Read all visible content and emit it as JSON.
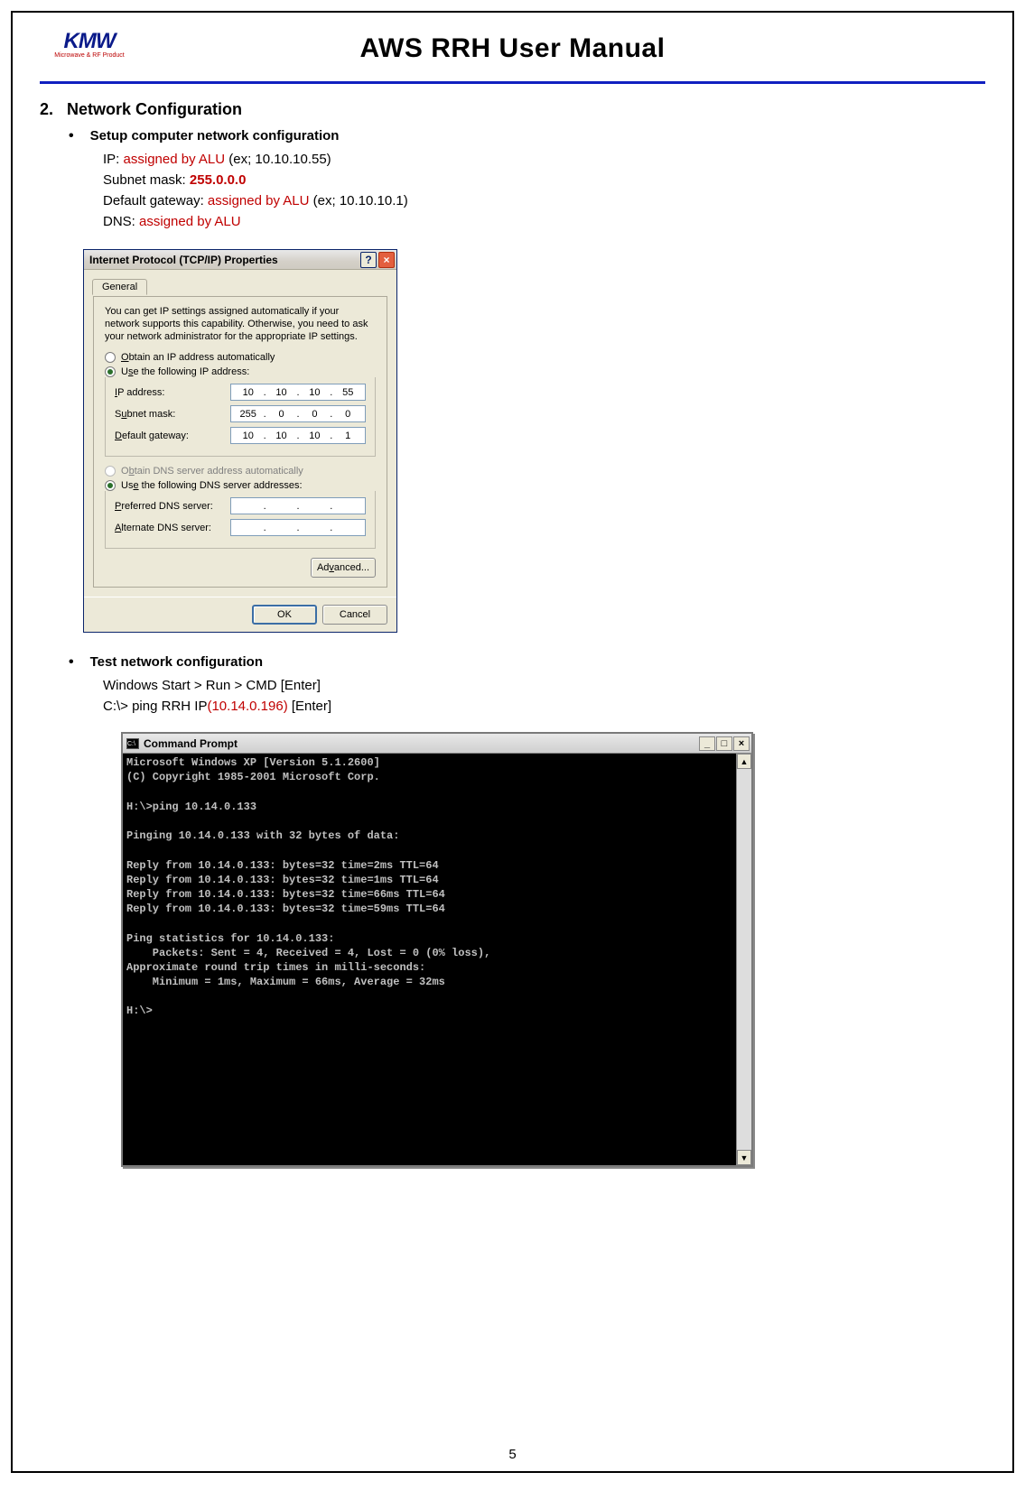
{
  "header": {
    "logo_text": "KMW",
    "logo_sub": "Microwave & RF Product",
    "doc_title": "AWS RRH User Manual"
  },
  "section": {
    "number": "2.",
    "title": "Network Configuration"
  },
  "bullet_setup": "Setup computer network configuration",
  "net_lines": {
    "ip_label": "IP: ",
    "ip_red": "assigned by ALU",
    "ip_ex": " (ex; 10.10.10.55)",
    "subnet_label": "Subnet mask: ",
    "subnet_red": "255.0.0.0",
    "gw_label": "Default gateway: ",
    "gw_red": "assigned by ALU",
    "gw_ex": " (ex; 10.10.10.1)",
    "dns_label": "DNS: ",
    "dns_red": "assigned by ALU"
  },
  "tcpip": {
    "title": "Internet Protocol (TCP/IP) Properties",
    "help_char": "?",
    "close_char": "×",
    "tab_general": "General",
    "explain": "You can get IP settings assigned automatically if your network supports this capability. Otherwise, you need to ask your network administrator for the appropriate IP settings.",
    "opt_auto_ip_pre": "O",
    "opt_auto_ip_rest": "btain an IP address automatically",
    "opt_use_ip_pre": "U",
    "opt_use_ip_mid": "s",
    "opt_use_ip_rest": "e the following IP address:",
    "lbl_ip_pre": "I",
    "lbl_ip_rest": "P address:",
    "lbl_subnet_pre": "S",
    "lbl_subnet_u": "u",
    "lbl_subnet_rest": "bnet mask:",
    "lbl_gw_pre": "D",
    "lbl_gw_rest": "efault gateway:",
    "ip": [
      "10",
      "10",
      "10",
      "55"
    ],
    "mask": [
      "255",
      "0",
      "0",
      "0"
    ],
    "gw": [
      "10",
      "10",
      "10",
      "1"
    ],
    "opt_auto_dns_pre": "O",
    "opt_auto_dns_u": "b",
    "opt_auto_dns_rest": "tain DNS server address automatically",
    "opt_use_dns_pre": "Us",
    "opt_use_dns_u": "e",
    "opt_use_dns_rest": " the following DNS server addresses:",
    "lbl_pref_dns_pre": "P",
    "lbl_pref_dns_rest": "referred DNS server:",
    "lbl_alt_dns_pre": "A",
    "lbl_alt_dns_rest": "lternate DNS server:",
    "dns1": [
      "",
      "",
      "",
      ""
    ],
    "dns2": [
      "",
      "",
      "",
      ""
    ],
    "btn_adv_pre": "Ad",
    "btn_adv_u": "v",
    "btn_adv_rest": "anced...",
    "btn_ok": "OK",
    "btn_cancel": "Cancel"
  },
  "bullet_test": "Test network configuration",
  "test_lines": {
    "line1": "Windows Start > Run > CMD [Enter]",
    "line2a": "C:\\> ping RRH IP",
    "line2b": "(10.14.0.196)",
    "line2c": " [Enter]"
  },
  "cmd": {
    "title": "Command Prompt",
    "min": "_",
    "max": "□",
    "close": "×",
    "up": "▲",
    "down": "▼",
    "text": "Microsoft Windows XP [Version 5.1.2600]\n(C) Copyright 1985-2001 Microsoft Corp.\n\nH:\\>ping 10.14.0.133\n\nPinging 10.14.0.133 with 32 bytes of data:\n\nReply from 10.14.0.133: bytes=32 time=2ms TTL=64\nReply from 10.14.0.133: bytes=32 time=1ms TTL=64\nReply from 10.14.0.133: bytes=32 time=66ms TTL=64\nReply from 10.14.0.133: bytes=32 time=59ms TTL=64\n\nPing statistics for 10.14.0.133:\n    Packets: Sent = 4, Received = 4, Lost = 0 (0% loss),\nApproximate round trip times in milli-seconds:\n    Minimum = 1ms, Maximum = 66ms, Average = 32ms\n\nH:\\>"
  },
  "page_number": "5"
}
